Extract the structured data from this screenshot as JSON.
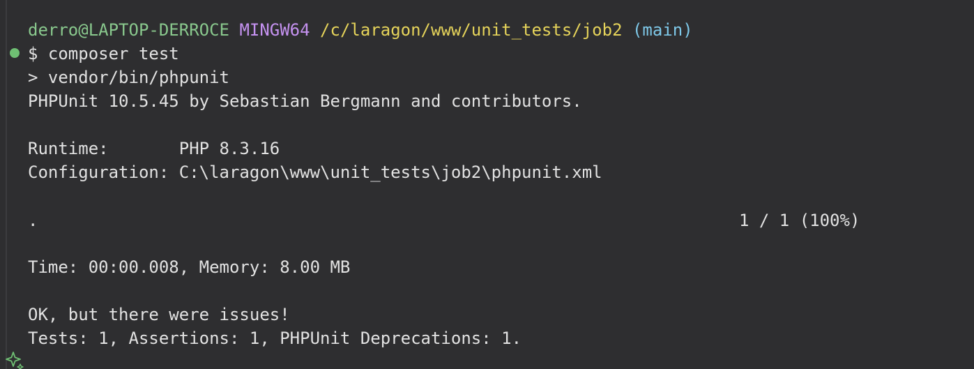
{
  "prompt": {
    "user_host": "derro@LAPTOP-DERROCE",
    "system": "MINGW64",
    "path": "/c/laragon/www/unit_tests/job2",
    "branch": "(main)"
  },
  "command": "$ composer test",
  "output": {
    "script": "> vendor/bin/phpunit",
    "banner": "PHPUnit 10.5.45 by Sebastian Bergmann and contributors.",
    "runtime": "Runtime:       PHP 8.3.16",
    "configuration": "Configuration: C:\\laragon\\www\\unit_tests\\job2\\phpunit.xml",
    "progress_dots": ".",
    "progress_count": "1 / 1 (100%)",
    "time_memory": "Time: 00:00.008, Memory: 8.00 MB",
    "result": "OK, but there were issues!",
    "summary": "Tests: 1, Assertions: 1, PHPUnit Deprecations: 1."
  },
  "colors": {
    "background": "#2e2e30",
    "user_host": "#89c88d",
    "system": "#c592f0",
    "path": "#e5d35a",
    "branch": "#7ec8e8",
    "status_dot": "#6fbf73"
  },
  "icons": {
    "status": "command-success-dot-icon",
    "sparkle": "sparkle-icon"
  }
}
